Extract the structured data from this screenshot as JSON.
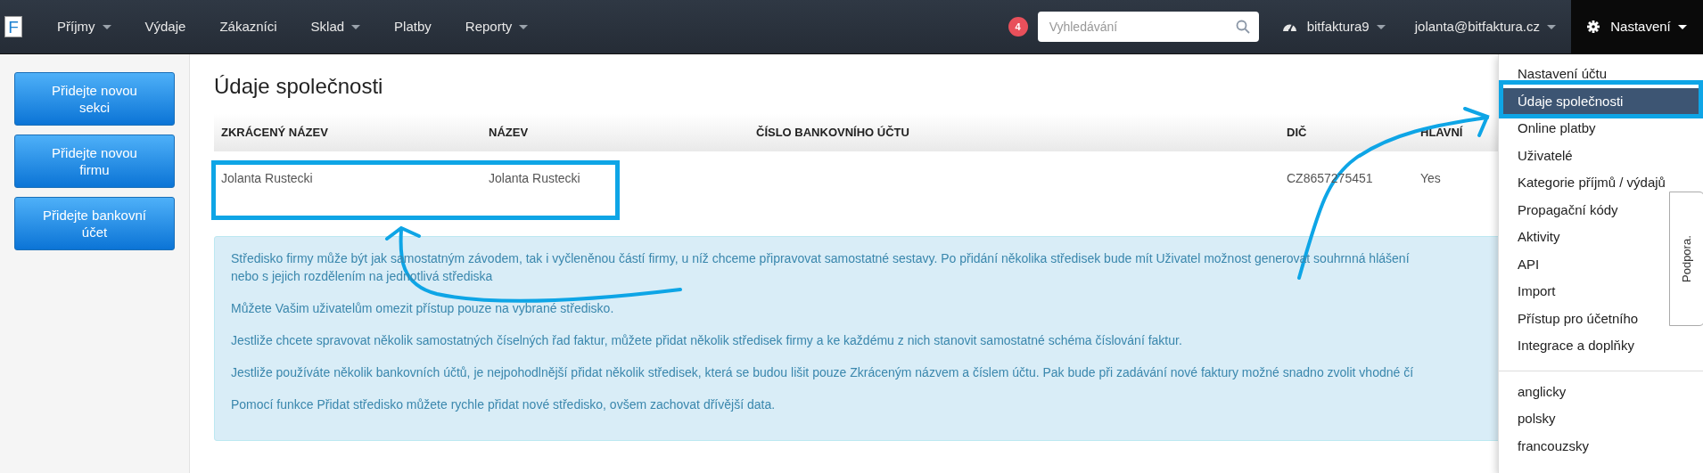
{
  "logo": "F",
  "nav": [
    {
      "label": "Příjmy",
      "dropdown": true
    },
    {
      "label": "Výdaje",
      "dropdown": false
    },
    {
      "label": "Zákazníci",
      "dropdown": false
    },
    {
      "label": "Sklad",
      "dropdown": true
    },
    {
      "label": "Platby",
      "dropdown": false
    },
    {
      "label": "Reporty",
      "dropdown": true
    }
  ],
  "notification_count": "4",
  "search": {
    "placeholder": "Vyhledávání"
  },
  "company_menu": {
    "label": "bitfaktura9",
    "dropdown": true
  },
  "user_menu": {
    "label": "jolanta@bitfaktura.cz",
    "dropdown": true
  },
  "settings_menu": {
    "label": "Nastavení",
    "expanded": true,
    "items": [
      {
        "label": "Nastavení účtu",
        "selected": false
      },
      {
        "label": "Údaje společnosti",
        "selected": true
      },
      {
        "label": "Online platby",
        "selected": false
      },
      {
        "label": "Uživatelé",
        "selected": false
      },
      {
        "label": "Kategorie příjmů / výdajů",
        "selected": false
      },
      {
        "label": "Propagační kódy",
        "selected": false
      },
      {
        "label": "Aktivity",
        "selected": false
      },
      {
        "label": "API",
        "selected": false
      },
      {
        "label": "Import",
        "selected": false
      },
      {
        "label": "Přístup pro účetního",
        "selected": false
      },
      {
        "label": "Integrace a doplňky",
        "selected": false
      }
    ],
    "languages": [
      "anglicky",
      "polsky",
      "francouzsky"
    ]
  },
  "sidebar_buttons": [
    "Přidejte novou sekci",
    "Přidejte novou firmu",
    "Přidejte bankovní účet"
  ],
  "page_title": "Údaje společnosti",
  "table": {
    "columns": [
      "ZKRÁCENÝ NÁZEV",
      "NÁZEV",
      "ČÍSLO BANKOVNÍHO ÚČTU",
      "DIČ",
      "HLAVNÍ"
    ],
    "rows": [
      [
        "Jolanta Rustecki",
        "Jolanta Rustecki",
        null,
        "CZ8657275451",
        "Yes"
      ]
    ]
  },
  "info": {
    "paragraphs": [
      [
        "Středisko firmy může být jak samostatným závodem, tak i vyčleněnou částí firmy, u níž chceme připravovat samostatné sestavy. Po přidání několika středisek bude mít Uživatel možnost generovat souhrnná hlášení",
        "nebo s jejich rozdělením na jednotlivá střediska"
      ],
      [
        "Můžete Vašim uživatelům omezit přístup pouze na vybrané středisko."
      ],
      [
        "Jestliže chcete spravovat několik samostatných číselných řad faktur, můžete přidat několik středisek firmy a ke každému z nich stanovit samostatné schéma číslování faktur."
      ],
      [
        "Jestliže používáte několik bankovních účtů, je nejpohodlnější přidat několik středisek, která se budou lišit pouze Zkráceným názvem a číslem účtu. Pak bude při zadávání nové faktury možné snadno zvolit vhodné čí"
      ],
      [
        "Pomocí funkce Přidat středisko můžete rychle přidat nové středisko, ovšem zachovat dřívější data."
      ]
    ]
  },
  "support_tab": "Podpora."
}
